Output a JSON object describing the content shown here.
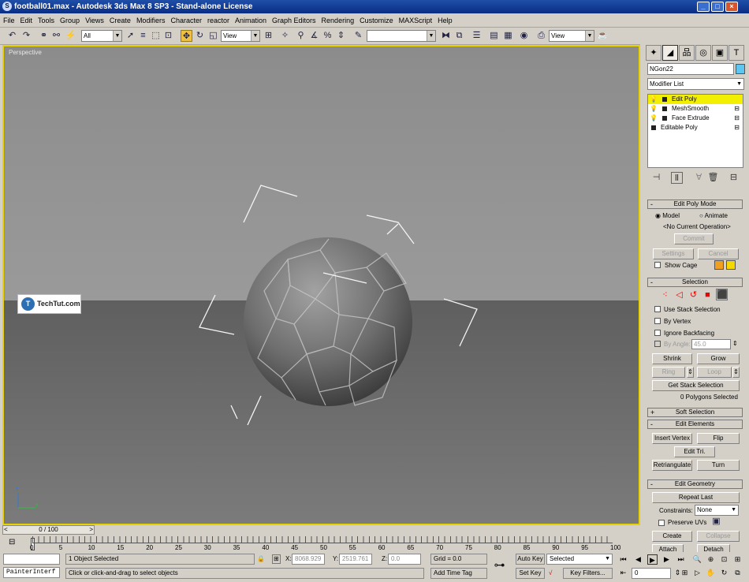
{
  "window": {
    "title": "football01.max - Autodesk 3ds Max 8 SP3 - Stand-alone License"
  },
  "menu": [
    "File",
    "Edit",
    "Tools",
    "Group",
    "Views",
    "Create",
    "Modifiers",
    "Character",
    "reactor",
    "Animation",
    "Graph Editors",
    "Rendering",
    "Customize",
    "MAXScript",
    "Help"
  ],
  "toolbar": {
    "filter_value": "All",
    "coord_value": "View",
    "named_sel_value": "",
    "ref_coord2": "View"
  },
  "viewport": {
    "label": "Perspective",
    "watermark": "TechTut.com",
    "watermark_initial": "T"
  },
  "command_panel": {
    "object_name": "NGon22",
    "object_color": "#5ec6f0",
    "modifier_list_label": "Modifier List",
    "stack": [
      {
        "label": "Edit Poly",
        "selected": true
      },
      {
        "label": "MeshSmooth",
        "selected": false
      },
      {
        "label": "Face Extrude",
        "selected": false
      },
      {
        "label": "Editable Poly",
        "selected": false
      }
    ],
    "edit_poly_mode": {
      "title": "Edit Poly Mode",
      "model": "Model",
      "animate": "Animate",
      "current_op": "<No Current Operation>",
      "commit": "Commit",
      "settings": "Settings",
      "cancel": "Cancel",
      "show_cage": "Show Cage",
      "cage_color1": "#f0a020",
      "cage_color2": "#f5d800"
    },
    "selection": {
      "title": "Selection",
      "use_stack": "Use Stack Selection",
      "by_vertex": "By Vertex",
      "ignore_backfacing": "Ignore Backfacing",
      "by_angle": "By Angle:",
      "angle_value": "45.0",
      "shrink": "Shrink",
      "grow": "Grow",
      "ring": "Ring",
      "loop": "Loop",
      "get_stack": "Get Stack Selection",
      "status": "0 Polygons Selected"
    },
    "soft_selection": {
      "title": "Soft Selection"
    },
    "edit_elements": {
      "title": "Edit Elements",
      "insert_vertex": "Insert Vertex",
      "flip": "Flip",
      "edit_tri": "Edit Tri.",
      "retriangulate": "Retriangulate",
      "turn": "Turn"
    },
    "edit_geometry": {
      "title": "Edit Geometry",
      "repeat_last": "Repeat Last",
      "constraints_label": "Constraints:",
      "constraints_value": "None",
      "preserve_uvs": "Preserve UVs",
      "create": "Create",
      "collapse": "Collapse",
      "attach": "Attach",
      "detach": "Detach"
    }
  },
  "timeline": {
    "slider_label": "0 / 100",
    "ticks": [
      "0",
      "5",
      "10",
      "15",
      "20",
      "25",
      "30",
      "35",
      "40",
      "45",
      "50",
      "55",
      "60",
      "65",
      "70",
      "75",
      "80",
      "85",
      "90",
      "95",
      "100"
    ]
  },
  "status": {
    "script_label": "PainterInterf",
    "selection_info": "1 Object Selected",
    "prompt": "Click or click-and-drag to select objects",
    "x_label": "X:",
    "x_value": "8068.929",
    "y_label": "Y:",
    "y_value": "2519.761",
    "z_label": "Z:",
    "z_value": "0.0",
    "grid": "Grid = 0.0",
    "add_time_tag": "Add Time Tag",
    "auto_key": "Auto Key",
    "auto_key_mode": "Selected",
    "set_key": "Set Key",
    "key_filters": "Key Filters...",
    "frame": "0"
  }
}
